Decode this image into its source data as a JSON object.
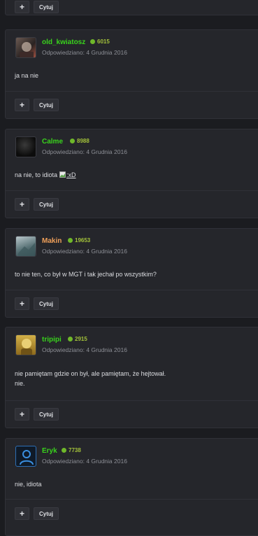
{
  "top_actions": {
    "plus_label": "+",
    "quote_label": "Cytuj"
  },
  "posts": [
    {
      "username": "old_kwiatosz",
      "username_color": "#39d31c",
      "reputation": "6015",
      "meta": "Odpowiedziano: 4 Grudnia 2016",
      "body": [
        "ja na nie"
      ],
      "plus_label": "+",
      "quote_label": "Cytuj"
    },
    {
      "username": "Calme",
      "username_color": "#39d31c",
      "reputation": "8988",
      "meta": "Odpowiedziano: 4 Grudnia 2016",
      "body": [
        "na nie, to idiota"
      ],
      "emoticon_alt": ":xD",
      "plus_label": "+",
      "quote_label": "Cytuj"
    },
    {
      "username": "Makin",
      "username_color": "#f0a05a",
      "reputation": "19653",
      "meta": "Odpowiedziano: 4 Grudnia 2016",
      "body": [
        "to nie ten, co był w MGT i tak jechał po wszystkim?"
      ],
      "plus_label": "+",
      "quote_label": "Cytuj"
    },
    {
      "username": "tripipi",
      "username_color": "#39d31c",
      "reputation": "2915",
      "meta": "Odpowiedziano: 4 Grudnia 2016",
      "body": [
        "nie pamiętam gdzie on był, ale pamiętam, że hejtował.",
        "nie."
      ],
      "plus_label": "+",
      "quote_label": "Cytuj"
    },
    {
      "username": "Eryk",
      "username_color": "#39d31c",
      "reputation": "7738",
      "meta": "Odpowiedziano: 4 Grudnia 2016",
      "body": [
        "nie, idiota"
      ],
      "plus_label": "+",
      "quote_label": "Cytuj"
    }
  ]
}
